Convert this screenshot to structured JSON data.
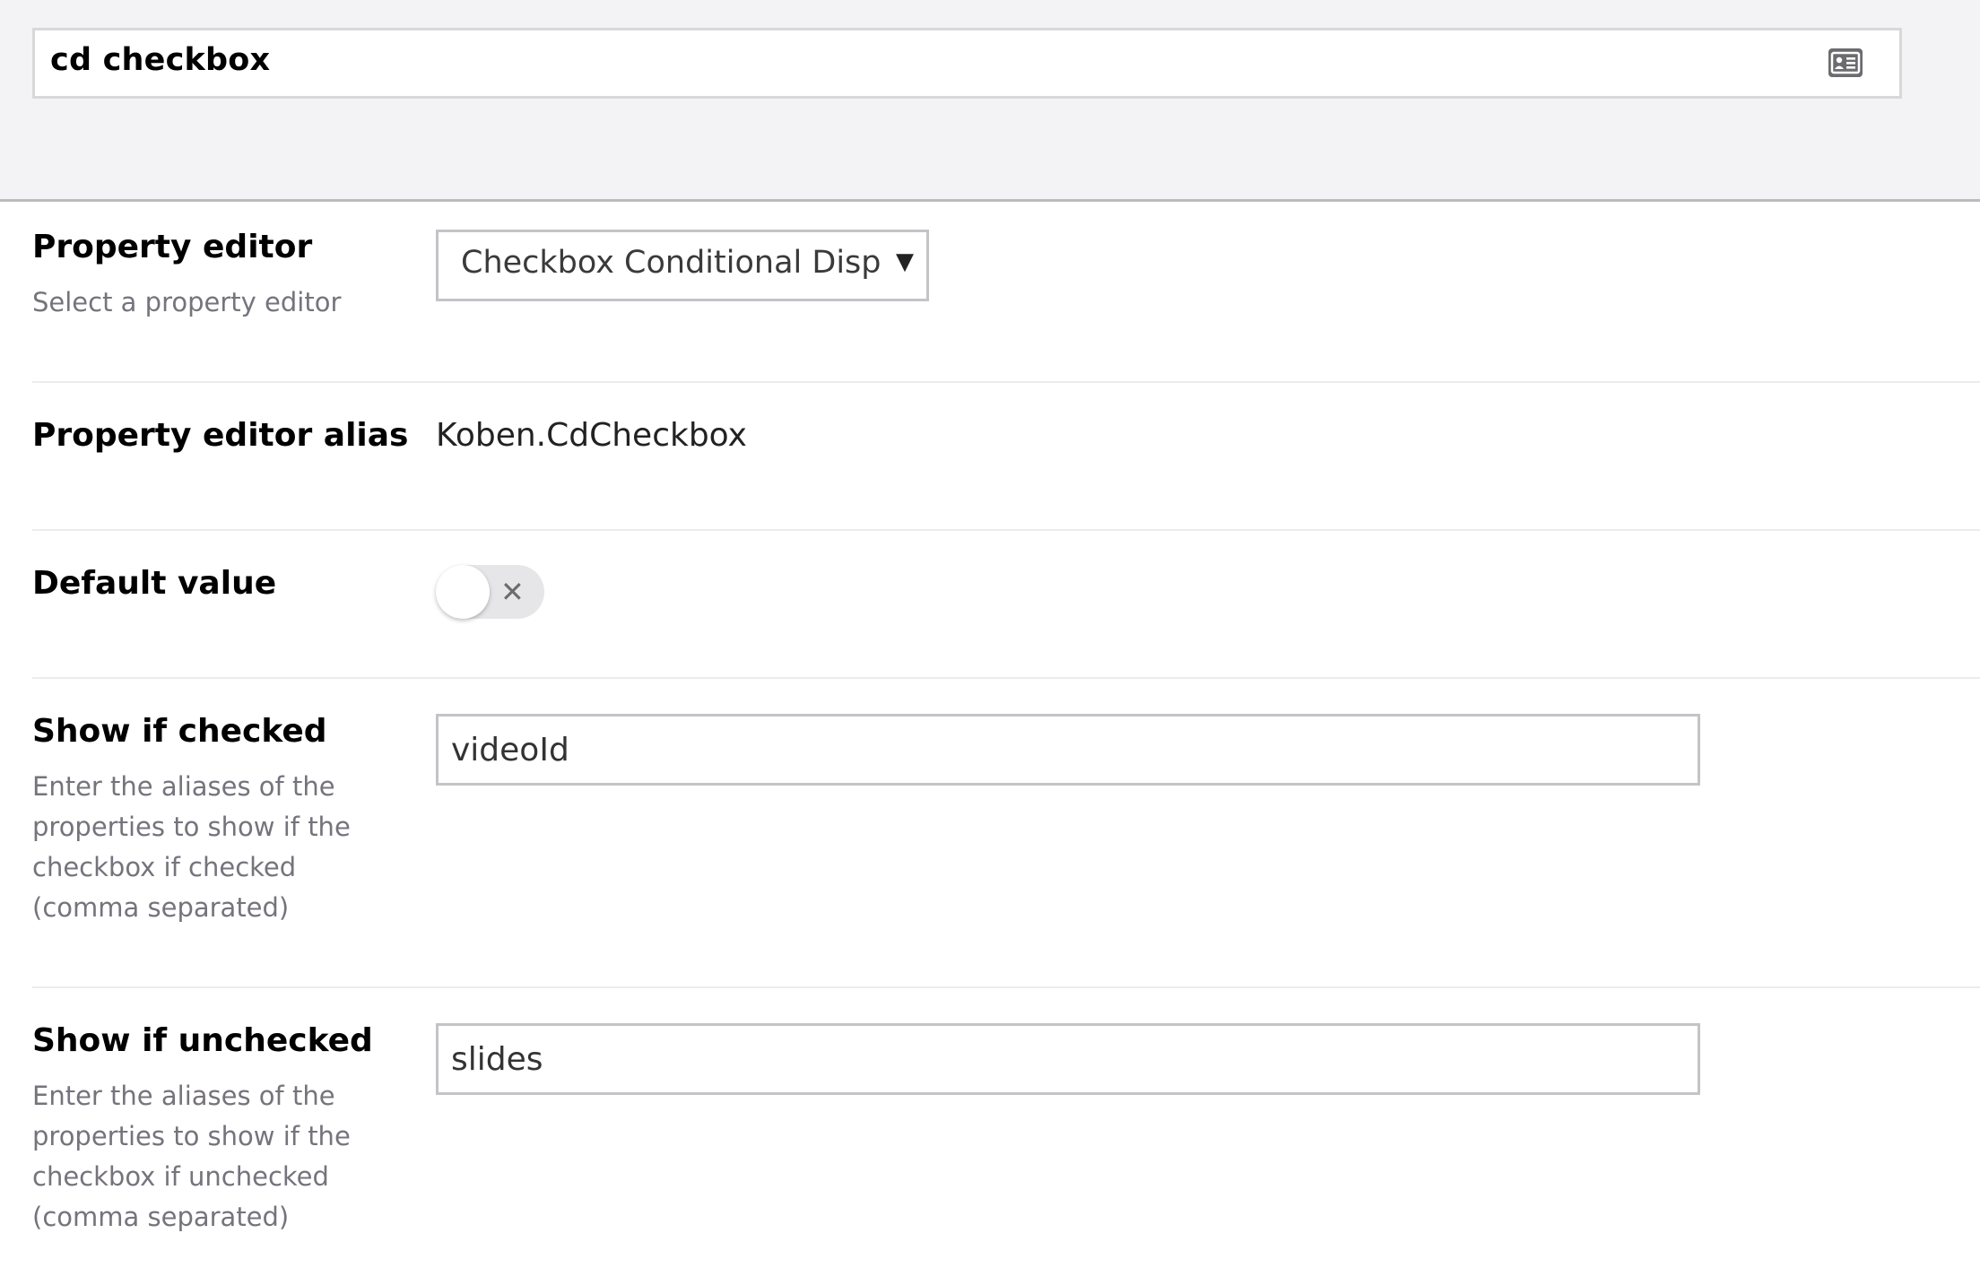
{
  "header": {
    "name_value": "cd checkbox",
    "name_icon": "id-card-icon"
  },
  "properties": {
    "editor": {
      "label": "Property editor",
      "description": "Select a property editor",
      "selected_value": "Checkbox Conditional Displayer",
      "dropdown_icon": "caret-down-icon"
    },
    "alias": {
      "label": "Property editor alias",
      "value": "Koben.CdCheckbox"
    },
    "default_value": {
      "label": "Default value",
      "toggle_state": "off",
      "toggle_icon": "close-icon",
      "toggle_glyph": "✕"
    },
    "show_if_checked": {
      "label": "Show if checked",
      "description": "Enter the aliases of the properties to show if the checkbox if checked (comma separated)",
      "value": "videoId"
    },
    "show_if_unchecked": {
      "label": "Show if unchecked",
      "description": "Enter the aliases of the properties to show if the checkbox if unchecked (comma separated)",
      "value": "slides"
    }
  }
}
